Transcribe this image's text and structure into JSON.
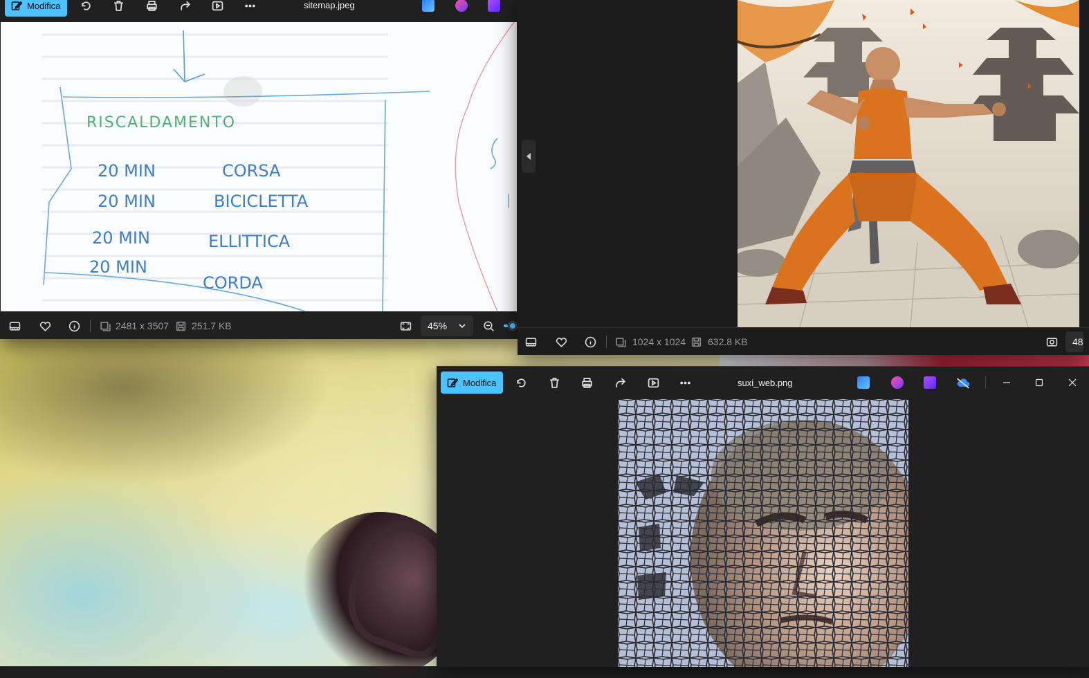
{
  "sitemap_window": {
    "edit_button": "Modifica",
    "file_name": "sitemap.jpeg",
    "dimensions": "2481 x 3507",
    "file_size": "251.7 KB",
    "zoom": "45%",
    "sketch_lines": {
      "heading": "RISCALDAMENTO",
      "row1_time": "20 MIN",
      "row1_activity": "CORSA",
      "row2_time": "20 MIN",
      "row2_activity": "BICICLETTA",
      "row3_time": "20 MIN",
      "row3_activity": "ELLITTICA",
      "row4_time": "20 MIN",
      "row4_activity": "CORDA"
    }
  },
  "monk_window": {
    "dimensions": "1024 x 1024",
    "file_size": "632.8 KB",
    "zoom_partial": "48"
  },
  "suxi_window": {
    "edit_button": "Modifica",
    "file_name": "suxi_web.png"
  },
  "colors": {
    "accent": "#4cc2ff",
    "window_bg": "#202020",
    "monk_robe": "#d9731e"
  }
}
